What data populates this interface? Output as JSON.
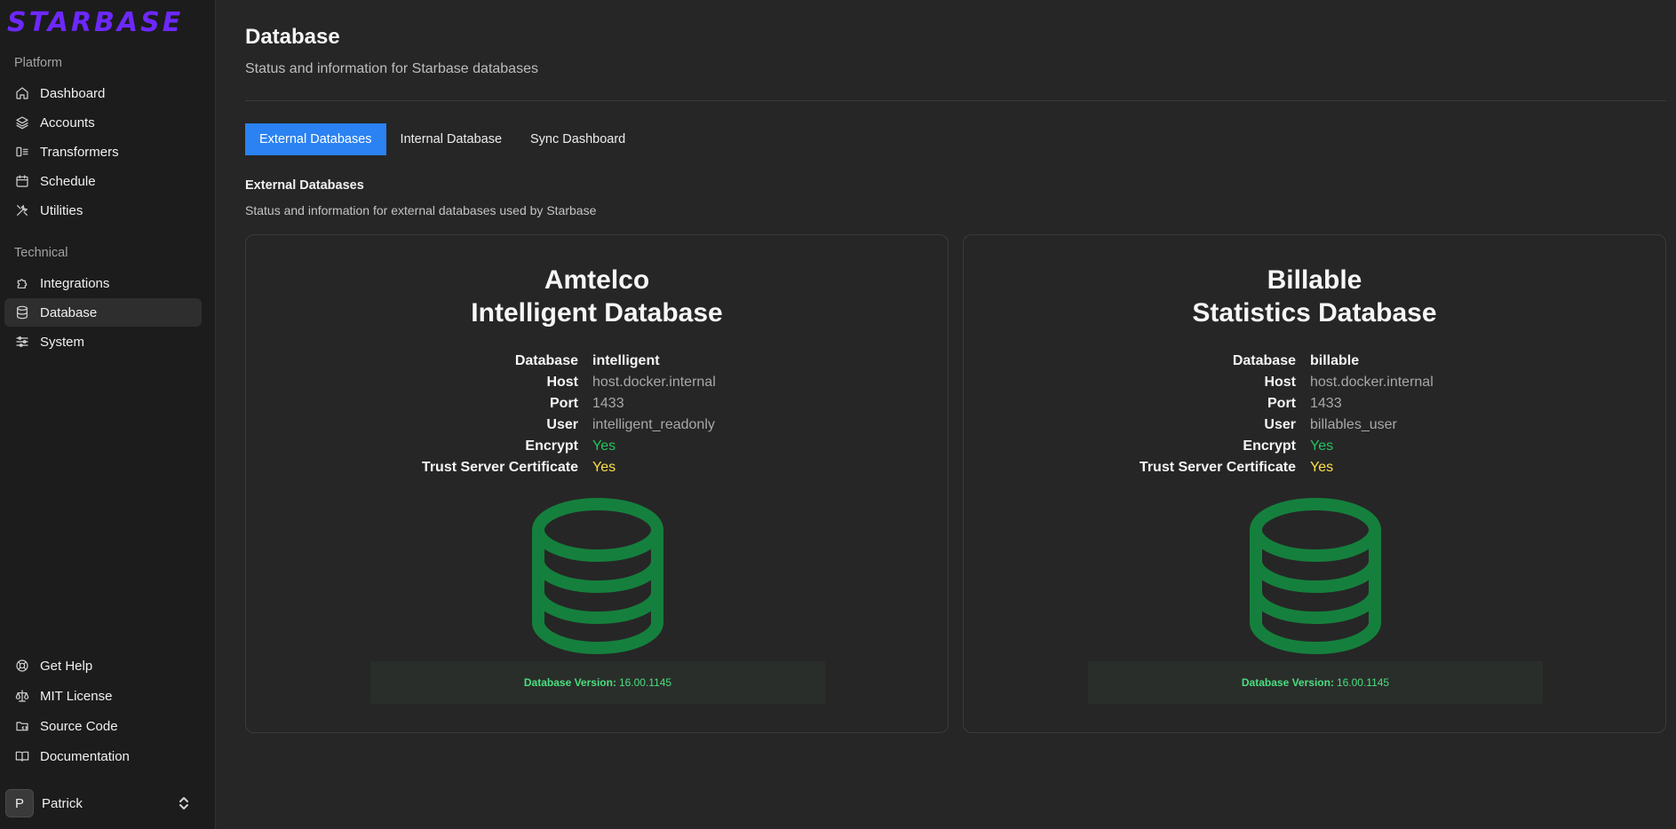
{
  "app": {
    "logo": "STARBASE"
  },
  "sidebar": {
    "sections": [
      {
        "label": "Platform"
      },
      {
        "label": "Technical"
      }
    ],
    "items": [
      {
        "label": "Dashboard",
        "icon": "home-icon"
      },
      {
        "label": "Accounts",
        "icon": "layers-icon"
      },
      {
        "label": "Transformers",
        "icon": "transformer-icon"
      },
      {
        "label": "Schedule",
        "icon": "calendar-icon"
      },
      {
        "label": "Utilities",
        "icon": "tools-icon"
      },
      {
        "label": "Integrations",
        "icon": "puzzle-icon"
      },
      {
        "label": "Database",
        "icon": "database-icon",
        "active": true
      },
      {
        "label": "System",
        "icon": "sliders-icon"
      }
    ],
    "footer_items": [
      {
        "label": "Get Help",
        "icon": "lifebuoy-icon"
      },
      {
        "label": "MIT License",
        "icon": "scale-icon"
      },
      {
        "label": "Source Code",
        "icon": "code-folder-icon"
      },
      {
        "label": "Documentation",
        "icon": "book-icon"
      }
    ],
    "user": {
      "initial": "P",
      "name": "Patrick"
    }
  },
  "page": {
    "title": "Database",
    "subtitle": "Status and information for Starbase databases"
  },
  "tabs": [
    {
      "label": "External Databases",
      "active": true
    },
    {
      "label": "Internal Database",
      "active": false
    },
    {
      "label": "Sync Dashboard",
      "active": false
    }
  ],
  "section": {
    "title": "External Databases",
    "description": "Status and information for external databases used by Starbase"
  },
  "cards": [
    {
      "title_line1": "Amtelco",
      "title_line2": "Intelligent Database",
      "fields": {
        "database_label": "Database",
        "database": "intelligent",
        "host_label": "Host",
        "host": "host.docker.internal",
        "port_label": "Port",
        "port": "1433",
        "user_label": "User",
        "user": "intelligent_readonly",
        "encrypt_label": "Encrypt",
        "encrypt": "Yes",
        "trust_label": "Trust Server Certificate",
        "trust": "Yes"
      },
      "version_label": "Database Version:",
      "version": "16.00.1145"
    },
    {
      "title_line1": "Billable",
      "title_line2": "Statistics Database",
      "fields": {
        "database_label": "Database",
        "database": "billable",
        "host_label": "Host",
        "host": "host.docker.internal",
        "port_label": "Port",
        "port": "1433",
        "user_label": "User",
        "user": "billables_user",
        "encrypt_label": "Encrypt",
        "encrypt": "Yes",
        "trust_label": "Trust Server Certificate",
        "trust": "Yes"
      },
      "version_label": "Database Version:",
      "version": "16.00.1145"
    }
  ],
  "colors": {
    "brand": "#6d28ff",
    "tab_active": "#2b82f2",
    "db_icon": "#15803d",
    "status_yes": "#22c55e",
    "status_warn": "#fde047"
  }
}
